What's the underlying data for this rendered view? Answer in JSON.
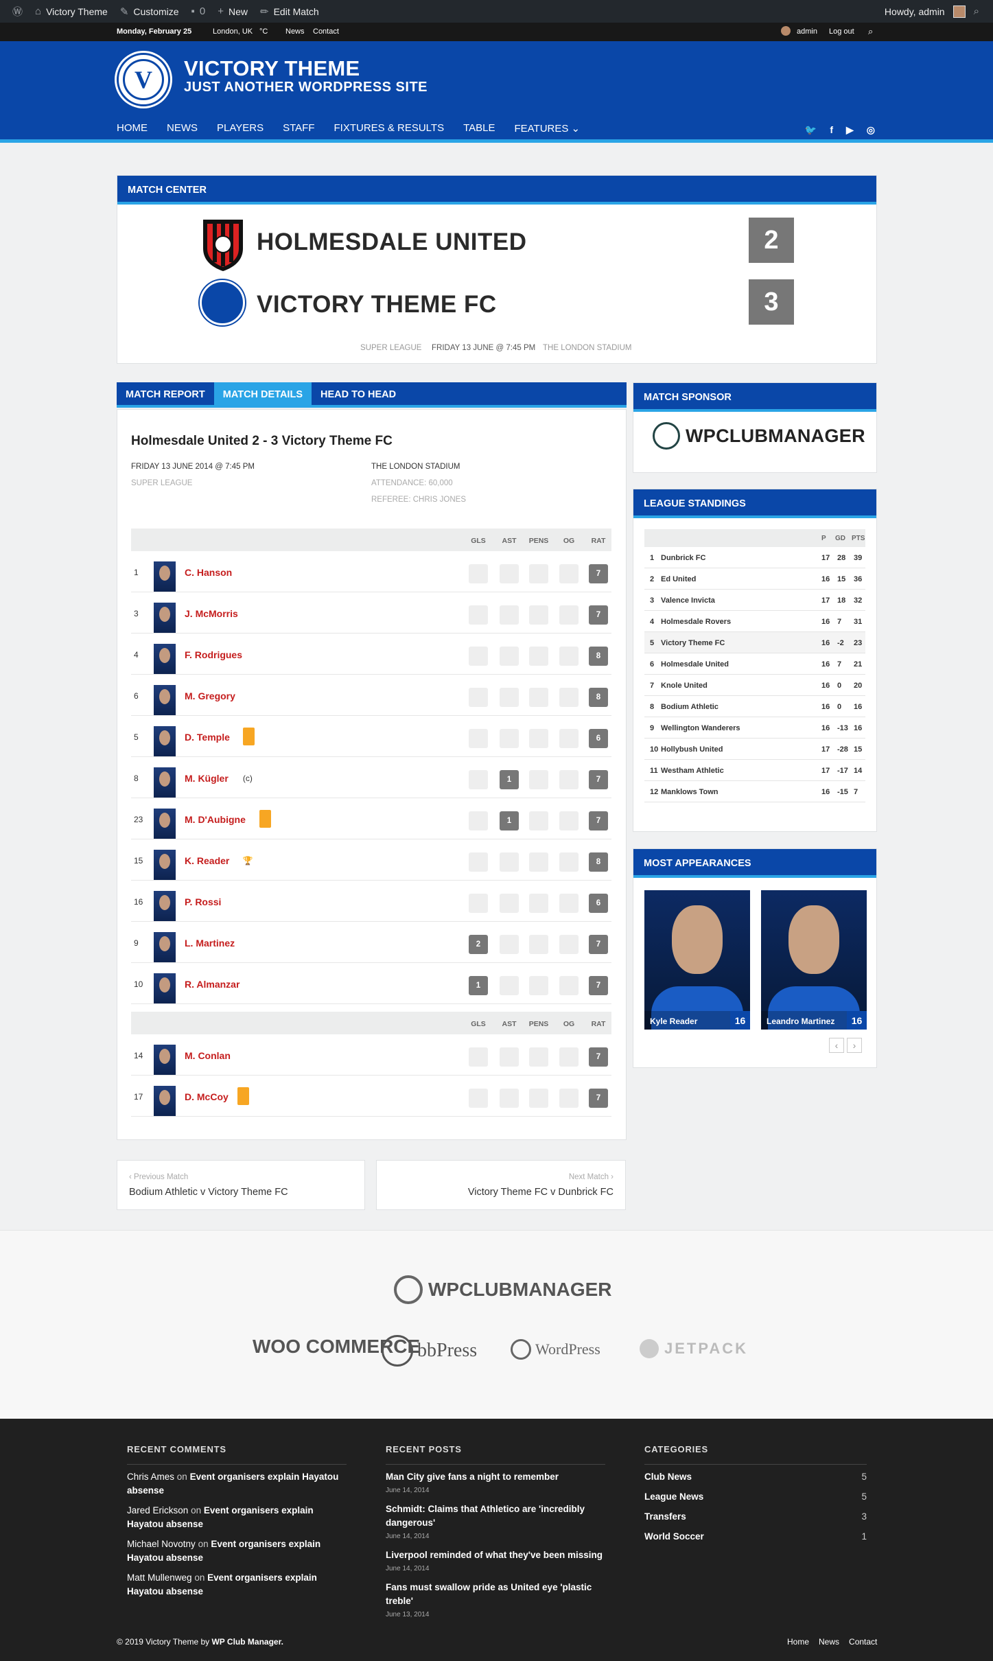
{
  "adminbar": {
    "site": "Victory Theme",
    "customize": "Customize",
    "comments": "0",
    "new": "New",
    "edit": "Edit Match",
    "howdy": "Howdy, admin"
  },
  "topbar": {
    "date": "Monday, February 25",
    "location": "London, UK",
    "temp": "°C",
    "news": "News",
    "contact": "Contact",
    "user": "admin",
    "logout": "Log out"
  },
  "site": {
    "title": "VICTORY THEME",
    "tagline": "JUST ANOTHER WORDPRESS SITE",
    "logo_text": "V"
  },
  "nav": [
    "HOME",
    "NEWS",
    "PLAYERS",
    "STAFF",
    "FIXTURES & RESULTS",
    "TABLE",
    "FEATURES ⌄"
  ],
  "social": {
    "twitter": "🐦",
    "facebook": "f",
    "youtube": "▶",
    "instagram": "◎"
  },
  "match": {
    "center_title": "MATCH CENTER",
    "home": "HOLMESDALE UNITED",
    "away": "VICTORY THEME FC",
    "home_score": "2",
    "away_score": "3",
    "league": "SUPER LEAGUE",
    "date": "FRIDAY 13 JUNE @ 7:45 PM",
    "venue": "THE LONDON STADIUM"
  },
  "tabs": [
    "MATCH REPORT",
    "MATCH DETAILS",
    "HEAD TO HEAD"
  ],
  "details": {
    "title": "Holmesdale United 2 - 3 Victory Theme FC",
    "date": "FRIDAY 13 JUNE 2014 @ 7:45 PM",
    "league": "SUPER LEAGUE",
    "venue": "THE LONDON STADIUM",
    "attendance": "ATTENDANCE: 60,000",
    "referee": "REFEREE: CHRIS JONES"
  },
  "cols": [
    "GLS",
    "AST",
    "PENS",
    "OG",
    "RAT"
  ],
  "lineup": [
    {
      "num": "1",
      "name": "C. Hanson",
      "gls": "",
      "ast": "",
      "rat": "7"
    },
    {
      "num": "3",
      "name": "J. McMorris",
      "gls": "",
      "ast": "",
      "rat": "7"
    },
    {
      "num": "4",
      "name": "F. Rodrigues",
      "gls": "",
      "ast": "",
      "rat": "8"
    },
    {
      "num": "6",
      "name": "M. Gregory",
      "gls": "",
      "ast": "",
      "rat": "8"
    },
    {
      "num": "5",
      "name": "D. Temple",
      "gls": "",
      "ast": "",
      "rat": "6",
      "card": true
    },
    {
      "num": "8",
      "name": "M. Kügler",
      "gls": "",
      "ast": "1",
      "rat": "7",
      "extra": "(c)"
    },
    {
      "num": "23",
      "name": "M. D'Aubigne",
      "gls": "",
      "ast": "1",
      "rat": "7",
      "card": true
    },
    {
      "num": "15",
      "name": "K. Reader",
      "gls": "",
      "ast": "",
      "rat": "8",
      "extra": "🏆"
    },
    {
      "num": "16",
      "name": "P. Rossi",
      "gls": "",
      "ast": "",
      "rat": "6"
    },
    {
      "num": "9",
      "name": "L. Martinez",
      "gls": "2",
      "ast": "",
      "rat": "7"
    },
    {
      "num": "10",
      "name": "R. Almanzar",
      "gls": "1",
      "ast": "",
      "rat": "7"
    }
  ],
  "subs": [
    {
      "num": "14",
      "name": "M. Conlan",
      "gls": "",
      "ast": "",
      "rat": "7"
    },
    {
      "num": "17",
      "name": "D. McCoy",
      "gls": "",
      "ast": "",
      "rat": "7",
      "card": true
    }
  ],
  "sponsor": {
    "title": "MATCH SPONSOR",
    "name": "WPCLUBMANAGER"
  },
  "standings": {
    "title": "LEAGUE STANDINGS",
    "cols": [
      "P",
      "GD",
      "PTS"
    ],
    "rows": [
      [
        "1",
        "Dunbrick FC",
        "17",
        "28",
        "39"
      ],
      [
        "2",
        "Ed United",
        "16",
        "15",
        "36"
      ],
      [
        "3",
        "Valence Invicta",
        "17",
        "18",
        "32"
      ],
      [
        "4",
        "Holmesdale Rovers",
        "16",
        "7",
        "31"
      ],
      [
        "5",
        "Victory Theme FC",
        "16",
        "-2",
        "23"
      ],
      [
        "6",
        "Holmesdale United",
        "16",
        "7",
        "21"
      ],
      [
        "7",
        "Knole United",
        "16",
        "0",
        "20"
      ],
      [
        "8",
        "Bodium Athletic",
        "16",
        "0",
        "16"
      ],
      [
        "9",
        "Wellington Wanderers",
        "16",
        "-13",
        "16"
      ],
      [
        "10",
        "Hollybush United",
        "17",
        "-28",
        "15"
      ],
      [
        "11",
        "Westham Athletic",
        "17",
        "-17",
        "14"
      ],
      [
        "12",
        "Manklows Town",
        "16",
        "-15",
        "7"
      ]
    ]
  },
  "appearances": {
    "title": "MOST APPEARANCES",
    "players": [
      {
        "name": "Kyle Reader",
        "count": "16"
      },
      {
        "name": "Leandro Martinez",
        "count": "16"
      }
    ]
  },
  "prevnext": {
    "prev_label": "‹ Previous Match",
    "prev": "Bodium Athletic v Victory Theme FC",
    "next_label": "Next Match ›",
    "next": "Victory Theme FC v Dunbrick FC"
  },
  "partners": {
    "main": "WPCLUBMANAGER",
    "woo": "WOO COMMERCE",
    "bb": "bbPress",
    "wp": "WordPress",
    "jet": "JETPACK"
  },
  "footer": {
    "comments_title": "RECENT COMMENTS",
    "comments": [
      {
        "who": "Chris Ames",
        "on": "on",
        "post": "Event organisers explain Hayatou absense"
      },
      {
        "who": "Jared Erickson",
        "on": "on",
        "post": "Event organisers explain Hayatou absense"
      },
      {
        "who": "Michael Novotny",
        "on": "on",
        "post": "Event organisers explain Hayatou absense"
      },
      {
        "who": "Matt Mullenweg",
        "on": "on",
        "post": "Event organisers explain Hayatou absense"
      }
    ],
    "posts_title": "RECENT POSTS",
    "posts": [
      {
        "t": "Man City give fans a night to remember",
        "d": "June 14, 2014"
      },
      {
        "t": "Schmidt: Claims that Athletico are 'incredibly dangerous'",
        "d": "June 14, 2014"
      },
      {
        "t": "Liverpool reminded of what they've been missing",
        "d": "June 14, 2014"
      },
      {
        "t": "Fans must swallow pride as United eye 'plastic treble'",
        "d": "June 13, 2014"
      }
    ],
    "cats_title": "CATEGORIES",
    "cats": [
      {
        "n": "Club News",
        "c": "5"
      },
      {
        "n": "League News",
        "c": "5"
      },
      {
        "n": "Transfers",
        "c": "3"
      },
      {
        "n": "World Soccer",
        "c": "1"
      }
    ],
    "copyright": "© 2019 Victory Theme by",
    "copyright_link": "WP Club Manager.",
    "links": [
      "Home",
      "News",
      "Contact"
    ]
  }
}
